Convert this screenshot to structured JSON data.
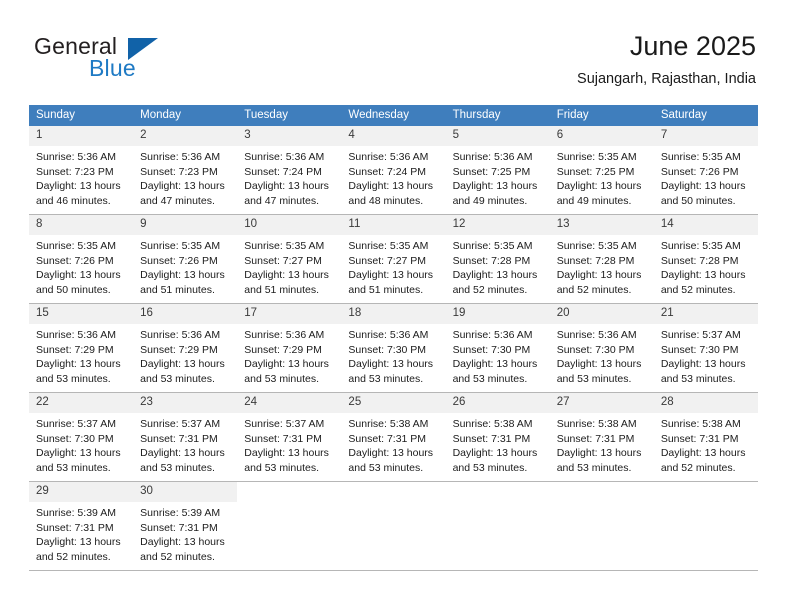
{
  "logo": {
    "word_top": "General",
    "word_bottom": "Blue",
    "triangle_color": "#1162a8",
    "blue_color": "#1f7ac4"
  },
  "header": {
    "title": "June 2025",
    "subtitle": "Sujangarh, Rajasthan, India",
    "header_bg": "#3f7ebd",
    "daynum_bg": "#f1f1f1",
    "row_border": "#b6b6b6"
  },
  "weekdays": [
    "Sunday",
    "Monday",
    "Tuesday",
    "Wednesday",
    "Thursday",
    "Friday",
    "Saturday"
  ],
  "weeks": [
    [
      {
        "day": "1",
        "sunrise": "Sunrise: 5:36 AM",
        "sunset": "Sunset: 7:23 PM",
        "daylight1": "Daylight: 13 hours",
        "daylight2": "and 46 minutes."
      },
      {
        "day": "2",
        "sunrise": "Sunrise: 5:36 AM",
        "sunset": "Sunset: 7:23 PM",
        "daylight1": "Daylight: 13 hours",
        "daylight2": "and 47 minutes."
      },
      {
        "day": "3",
        "sunrise": "Sunrise: 5:36 AM",
        "sunset": "Sunset: 7:24 PM",
        "daylight1": "Daylight: 13 hours",
        "daylight2": "and 47 minutes."
      },
      {
        "day": "4",
        "sunrise": "Sunrise: 5:36 AM",
        "sunset": "Sunset: 7:24 PM",
        "daylight1": "Daylight: 13 hours",
        "daylight2": "and 48 minutes."
      },
      {
        "day": "5",
        "sunrise": "Sunrise: 5:36 AM",
        "sunset": "Sunset: 7:25 PM",
        "daylight1": "Daylight: 13 hours",
        "daylight2": "and 49 minutes."
      },
      {
        "day": "6",
        "sunrise": "Sunrise: 5:35 AM",
        "sunset": "Sunset: 7:25 PM",
        "daylight1": "Daylight: 13 hours",
        "daylight2": "and 49 minutes."
      },
      {
        "day": "7",
        "sunrise": "Sunrise: 5:35 AM",
        "sunset": "Sunset: 7:26 PM",
        "daylight1": "Daylight: 13 hours",
        "daylight2": "and 50 minutes."
      }
    ],
    [
      {
        "day": "8",
        "sunrise": "Sunrise: 5:35 AM",
        "sunset": "Sunset: 7:26 PM",
        "daylight1": "Daylight: 13 hours",
        "daylight2": "and 50 minutes."
      },
      {
        "day": "9",
        "sunrise": "Sunrise: 5:35 AM",
        "sunset": "Sunset: 7:26 PM",
        "daylight1": "Daylight: 13 hours",
        "daylight2": "and 51 minutes."
      },
      {
        "day": "10",
        "sunrise": "Sunrise: 5:35 AM",
        "sunset": "Sunset: 7:27 PM",
        "daylight1": "Daylight: 13 hours",
        "daylight2": "and 51 minutes."
      },
      {
        "day": "11",
        "sunrise": "Sunrise: 5:35 AM",
        "sunset": "Sunset: 7:27 PM",
        "daylight1": "Daylight: 13 hours",
        "daylight2": "and 51 minutes."
      },
      {
        "day": "12",
        "sunrise": "Sunrise: 5:35 AM",
        "sunset": "Sunset: 7:28 PM",
        "daylight1": "Daylight: 13 hours",
        "daylight2": "and 52 minutes."
      },
      {
        "day": "13",
        "sunrise": "Sunrise: 5:35 AM",
        "sunset": "Sunset: 7:28 PM",
        "daylight1": "Daylight: 13 hours",
        "daylight2": "and 52 minutes."
      },
      {
        "day": "14",
        "sunrise": "Sunrise: 5:35 AM",
        "sunset": "Sunset: 7:28 PM",
        "daylight1": "Daylight: 13 hours",
        "daylight2": "and 52 minutes."
      }
    ],
    [
      {
        "day": "15",
        "sunrise": "Sunrise: 5:36 AM",
        "sunset": "Sunset: 7:29 PM",
        "daylight1": "Daylight: 13 hours",
        "daylight2": "and 53 minutes."
      },
      {
        "day": "16",
        "sunrise": "Sunrise: 5:36 AM",
        "sunset": "Sunset: 7:29 PM",
        "daylight1": "Daylight: 13 hours",
        "daylight2": "and 53 minutes."
      },
      {
        "day": "17",
        "sunrise": "Sunrise: 5:36 AM",
        "sunset": "Sunset: 7:29 PM",
        "daylight1": "Daylight: 13 hours",
        "daylight2": "and 53 minutes."
      },
      {
        "day": "18",
        "sunrise": "Sunrise: 5:36 AM",
        "sunset": "Sunset: 7:30 PM",
        "daylight1": "Daylight: 13 hours",
        "daylight2": "and 53 minutes."
      },
      {
        "day": "19",
        "sunrise": "Sunrise: 5:36 AM",
        "sunset": "Sunset: 7:30 PM",
        "daylight1": "Daylight: 13 hours",
        "daylight2": "and 53 minutes."
      },
      {
        "day": "20",
        "sunrise": "Sunrise: 5:36 AM",
        "sunset": "Sunset: 7:30 PM",
        "daylight1": "Daylight: 13 hours",
        "daylight2": "and 53 minutes."
      },
      {
        "day": "21",
        "sunrise": "Sunrise: 5:37 AM",
        "sunset": "Sunset: 7:30 PM",
        "daylight1": "Daylight: 13 hours",
        "daylight2": "and 53 minutes."
      }
    ],
    [
      {
        "day": "22",
        "sunrise": "Sunrise: 5:37 AM",
        "sunset": "Sunset: 7:30 PM",
        "daylight1": "Daylight: 13 hours",
        "daylight2": "and 53 minutes."
      },
      {
        "day": "23",
        "sunrise": "Sunrise: 5:37 AM",
        "sunset": "Sunset: 7:31 PM",
        "daylight1": "Daylight: 13 hours",
        "daylight2": "and 53 minutes."
      },
      {
        "day": "24",
        "sunrise": "Sunrise: 5:37 AM",
        "sunset": "Sunset: 7:31 PM",
        "daylight1": "Daylight: 13 hours",
        "daylight2": "and 53 minutes."
      },
      {
        "day": "25",
        "sunrise": "Sunrise: 5:38 AM",
        "sunset": "Sunset: 7:31 PM",
        "daylight1": "Daylight: 13 hours",
        "daylight2": "and 53 minutes."
      },
      {
        "day": "26",
        "sunrise": "Sunrise: 5:38 AM",
        "sunset": "Sunset: 7:31 PM",
        "daylight1": "Daylight: 13 hours",
        "daylight2": "and 53 minutes."
      },
      {
        "day": "27",
        "sunrise": "Sunrise: 5:38 AM",
        "sunset": "Sunset: 7:31 PM",
        "daylight1": "Daylight: 13 hours",
        "daylight2": "and 53 minutes."
      },
      {
        "day": "28",
        "sunrise": "Sunrise: 5:38 AM",
        "sunset": "Sunset: 7:31 PM",
        "daylight1": "Daylight: 13 hours",
        "daylight2": "and 52 minutes."
      }
    ],
    [
      {
        "day": "29",
        "sunrise": "Sunrise: 5:39 AM",
        "sunset": "Sunset: 7:31 PM",
        "daylight1": "Daylight: 13 hours",
        "daylight2": "and 52 minutes."
      },
      {
        "day": "30",
        "sunrise": "Sunrise: 5:39 AM",
        "sunset": "Sunset: 7:31 PM",
        "daylight1": "Daylight: 13 hours",
        "daylight2": "and 52 minutes."
      },
      {
        "day": "",
        "sunrise": "",
        "sunset": "",
        "daylight1": "",
        "daylight2": ""
      },
      {
        "day": "",
        "sunrise": "",
        "sunset": "",
        "daylight1": "",
        "daylight2": ""
      },
      {
        "day": "",
        "sunrise": "",
        "sunset": "",
        "daylight1": "",
        "daylight2": ""
      },
      {
        "day": "",
        "sunrise": "",
        "sunset": "",
        "daylight1": "",
        "daylight2": ""
      },
      {
        "day": "",
        "sunrise": "",
        "sunset": "",
        "daylight1": "",
        "daylight2": ""
      }
    ]
  ]
}
